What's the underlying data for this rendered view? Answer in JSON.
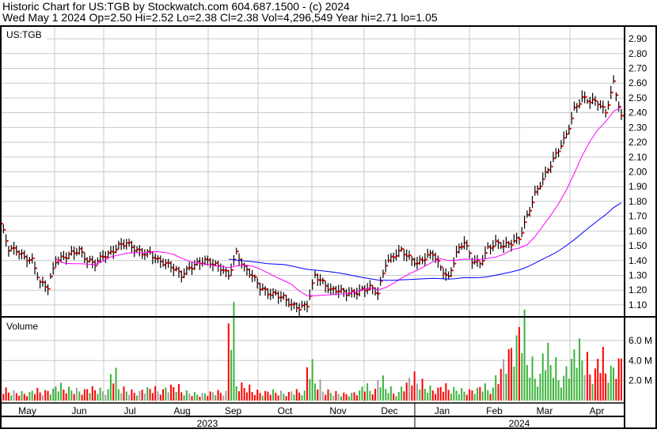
{
  "header": {
    "title": "Historic Chart for US:TGB by Stockwatch.com 604.687.1500 - (c) 2024",
    "quote": "Wed May  1 2024  Op=2.50  Hi=2.52  Lo=2.38  Cl=2.38  Vol=4,296,549  Year hi=2.71  lo=1.05"
  },
  "colors": {
    "up": "#3cb33c",
    "down": "#ff0000",
    "flat": "#a0a0a0",
    "ma_short": "#ff00ff",
    "ma_long": "#0000ff",
    "grid": "#c8c8c8"
  },
  "chart_data": {
    "type": "bar",
    "symbol_label": "US:TGB",
    "volume_label": "Volume",
    "price_ticks": [
      "2.90",
      "2.80",
      "2.70",
      "2.60",
      "2.50",
      "2.40",
      "2.30",
      "2.20",
      "2.10",
      "2.00",
      "1.90",
      "1.80",
      "1.70",
      "1.60",
      "1.50",
      "1.40",
      "1.30",
      "1.20",
      "1.10"
    ],
    "price_range": [
      1.03,
      2.97
    ],
    "volume_ticks": [
      "6.0 M",
      "4.0 M",
      "2.0 M"
    ],
    "volume_range_millions": [
      0,
      8.2
    ],
    "months": [
      "May",
      "Jun",
      "Jul",
      "Aug",
      "Sep",
      "Oct",
      "Nov",
      "Dec",
      "Jan",
      "Feb",
      "Mar",
      "Apr"
    ],
    "years": [
      "2023",
      "2024"
    ],
    "sample_every_trading_days": 3,
    "closes": [
      1.65,
      1.48,
      1.47,
      1.42,
      1.4,
      1.25,
      1.22,
      1.4,
      1.42,
      1.45,
      1.47,
      1.4,
      1.38,
      1.43,
      1.45,
      1.5,
      1.52,
      1.48,
      1.45,
      1.45,
      1.4,
      1.38,
      1.35,
      1.3,
      1.35,
      1.38,
      1.4,
      1.38,
      1.35,
      1.3,
      1.45,
      1.35,
      1.3,
      1.22,
      1.18,
      1.17,
      1.15,
      1.1,
      1.08,
      1.1,
      1.3,
      1.25,
      1.2,
      1.2,
      1.18,
      1.18,
      1.2,
      1.22,
      1.18,
      1.38,
      1.43,
      1.47,
      1.42,
      1.38,
      1.42,
      1.45,
      1.35,
      1.28,
      1.45,
      1.53,
      1.4,
      1.38,
      1.48,
      1.52,
      1.5,
      1.52,
      1.55,
      1.7,
      1.85,
      1.95,
      2.05,
      2.15,
      2.25,
      2.42,
      2.5,
      2.48,
      2.47,
      2.4,
      2.6,
      2.38
    ],
    "volumes_millions": [
      1.2,
      0.9,
      0.8,
      0.7,
      1.0,
      0.8,
      0.9,
      1.3,
      1.0,
      0.9,
      0.8,
      1.0,
      0.9,
      0.8,
      2.3,
      1.0,
      0.8,
      0.7,
      1.0,
      1.1,
      0.9,
      1.3,
      1.4,
      0.9,
      0.8,
      0.7,
      0.8,
      0.9,
      0.8,
      7.8,
      1.4,
      1.2,
      0.8,
      0.7,
      0.8,
      0.7,
      0.6,
      0.8,
      0.7,
      2.9,
      1.5,
      0.8,
      0.7,
      0.6,
      0.6,
      0.8,
      1.4,
      1.0,
      2.2,
      1.3,
      0.8,
      1.6,
      2.5,
      1.8,
      1.2,
      1.0,
      1.3,
      1.0,
      0.9,
      0.8,
      0.9,
      1.2,
      0.9,
      2.2,
      3.6,
      4.6,
      6.5,
      3.2,
      2.0,
      4.4,
      3.4,
      2.0,
      3.5,
      5.4,
      4.4,
      3.0,
      4.8,
      3.0,
      3.5,
      4.3
    ],
    "ma_windows_samples": [
      8,
      30
    ],
    "last_close": 2.38
  }
}
